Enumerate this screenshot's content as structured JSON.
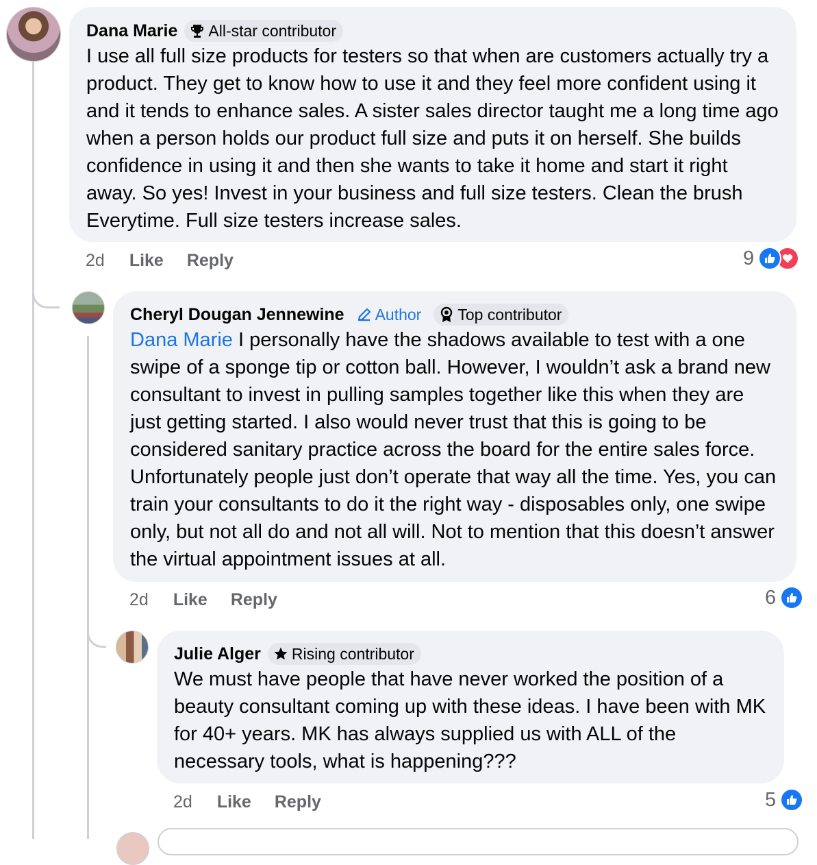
{
  "comments": [
    {
      "author": "Dana Marie",
      "badge": "All-star contributor",
      "badge_icon": "trophy-icon",
      "text": "I use all full size products for testers so that when are customers actually try a product. They get to know how to use it and they feel more confident using it and it tends to enhance sales. A sister sales director taught me a long time ago when a person holds our product full size and puts it on herself. She builds confidence in using it and then she wants to take it home and start it right away. So yes! Invest in your business and full size testers. Clean the brush Everytime. Full size testers increase sales.",
      "time": "2d",
      "like_label": "Like",
      "reply_label": "Reply",
      "reaction_count": "9",
      "reactions": [
        "like-icon",
        "love-icon"
      ]
    },
    {
      "author": "Cheryl Dougan Jennewine",
      "author_tag": "Author",
      "author_tag_icon": "pencil-icon",
      "badge": "Top contributor",
      "badge_icon": "award-ribbon-icon",
      "mention": "Dana Marie",
      "text": " I personally have the shadows available to test with a one swipe of a sponge tip or cotton ball. However, I wouldn’t ask a brand new consultant to invest in pulling samples together like this when they are just getting started. I also would never trust that this is going to be considered sanitary practice across the board for the entire sales force. Unfortunately people just don’t operate that way all the time. Yes, you can train your consultants to do it the right way - disposables only, one swipe only, but not all do and not all will. Not to mention that this doesn’t answer the virtual appointment issues at all.",
      "time": "2d",
      "like_label": "Like",
      "reply_label": "Reply",
      "reaction_count": "6",
      "reactions": [
        "like-icon"
      ]
    },
    {
      "author": "Julie Alger",
      "badge": "Rising contributor",
      "badge_icon": "star-icon",
      "text": "We must have people that have never worked the position of a beauty consultant coming up with these ideas. I have been with MK for 40+ years. MK has always supplied us with ALL of the necessary tools, what is happening???",
      "time": "2d",
      "like_label": "Like",
      "reply_label": "Reply",
      "reaction_count": "5",
      "reactions": [
        "like-icon"
      ]
    }
  ],
  "colors": {
    "bubble": "#f0f2f5",
    "badge": "#e4e6eb",
    "link": "#1b74e4",
    "secondary_text": "#65676b",
    "like": "#1877f2",
    "love": "#f33e58",
    "thread_line": "#ced0d4"
  }
}
